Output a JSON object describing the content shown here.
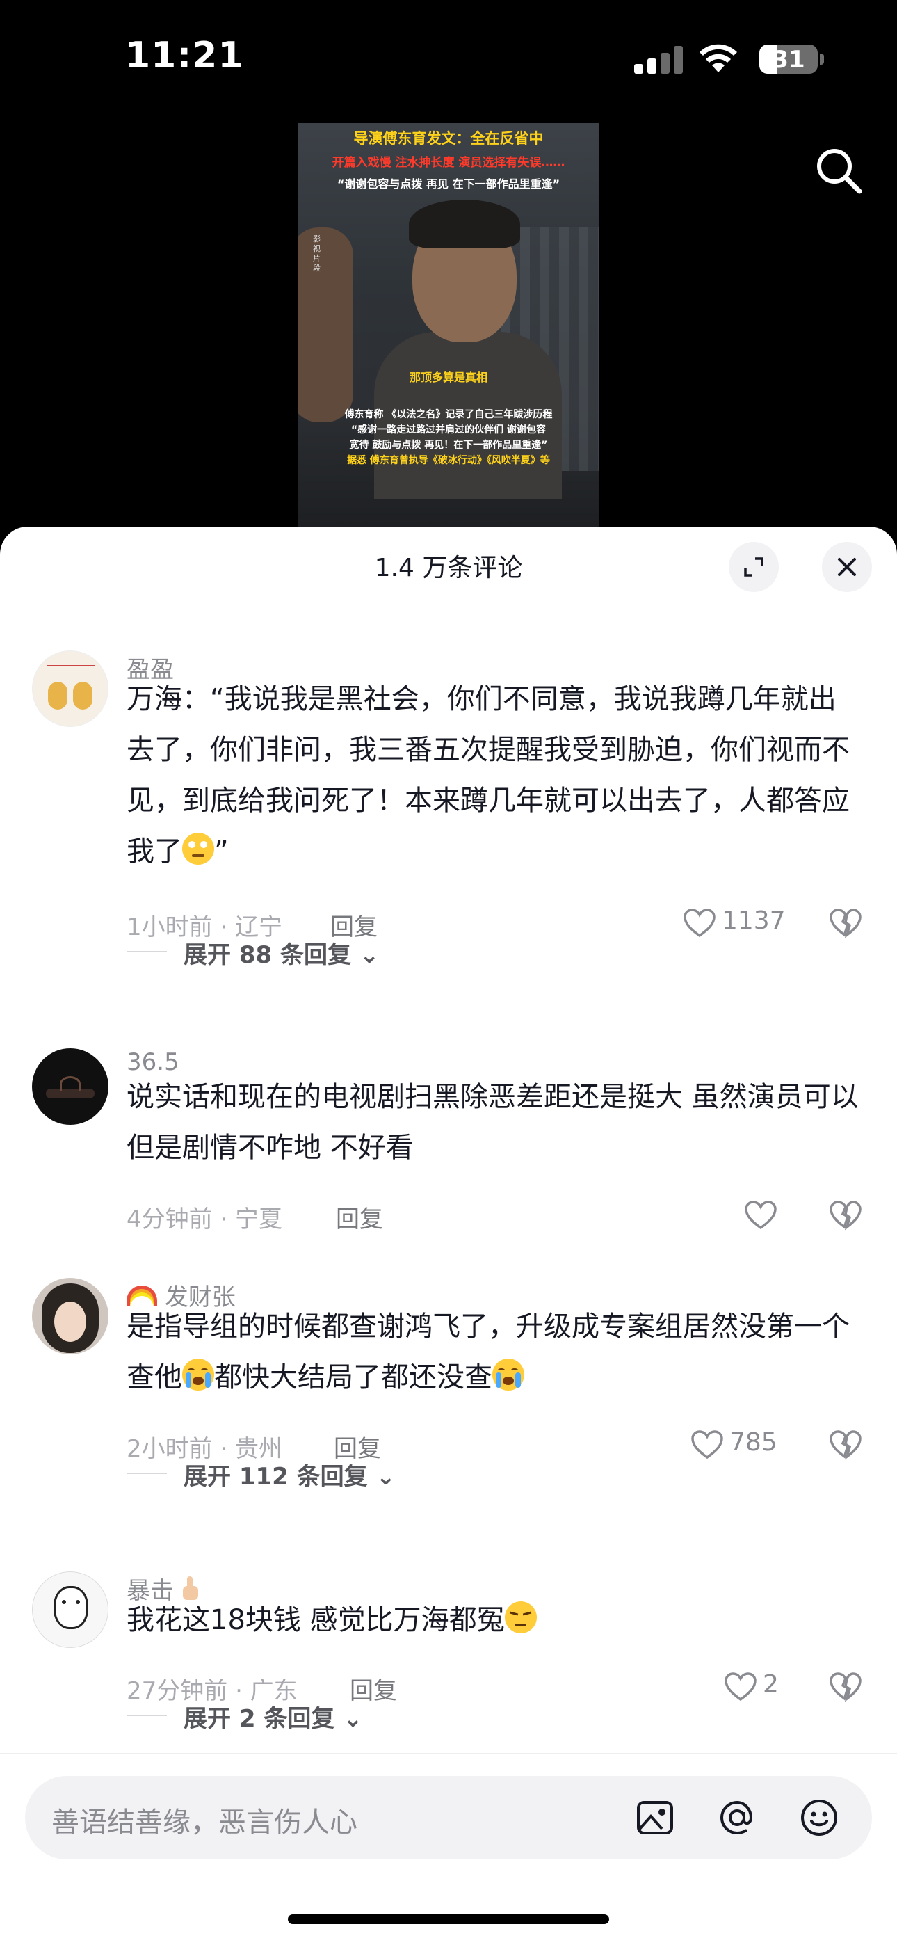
{
  "status": {
    "time": "11:21",
    "battery": "31"
  },
  "video": {
    "headline": "导演傅东育发文：全在反省中",
    "subheadline": "开篇入戏慢 注水抻长度 演员选择有失误……",
    "quote": "“谢谢包容与点拨 再见 在下一部作品里重逢”",
    "side_label": "影视片段",
    "subtitle": "那顶多算是真相",
    "caption_line1": "傅东育称 《以法之名》记录了自己三年跋涉历程",
    "caption_line2": "“感谢一路走过路过并肩过的伙伴们 谢谢包容",
    "caption_line3": "宽待 鼓励与点拨 再见！在下一部作品里重逢”",
    "caption_line4": "据悉 傅东育曾执导《破冰行动》《风吹半夏》等"
  },
  "sheet": {
    "title": "1.4 万条评论"
  },
  "comments": [
    {
      "username": "盈盈",
      "text": "万海：“我说我是黑社会，你们不同意，我说我蹲几年就出去了，你们非问，我三番五次提醒我受到胁迫，你们视而不见，到底给我问死了！本来蹲几年就可以出去了，人都答应我了",
      "text_end": "”",
      "time_location": "1小时前 · 辽宁",
      "reply_label": "回复",
      "likes": "1137",
      "expand": "展开 88 条回复"
    },
    {
      "username": "36.5",
      "text": "说实话和现在的电视剧扫黑除恶差距还是挺大 虽然演员可以 但是剧情不咋地  不好看",
      "time_location": "4分钟前 · 宁夏",
      "reply_label": "回复",
      "likes": ""
    },
    {
      "username": "发财张",
      "text_part1": "是指导组的时候都查谢鸿飞了，升级成专案组居然没第一个查他",
      "text_part2": "都快大结局了都还没查",
      "time_location": "2小时前 · 贵州",
      "reply_label": "回复",
      "likes": "785",
      "expand": "展开 112 条回复"
    },
    {
      "username": "暴击",
      "text": "我花这18块钱 感觉比万海都冤",
      "time_location": "27分钟前 · 广东",
      "reply_label": "回复",
      "likes": "2",
      "expand": "展开 2 条回复"
    }
  ],
  "input": {
    "placeholder": "善语结善缘，恶言伤人心"
  }
}
